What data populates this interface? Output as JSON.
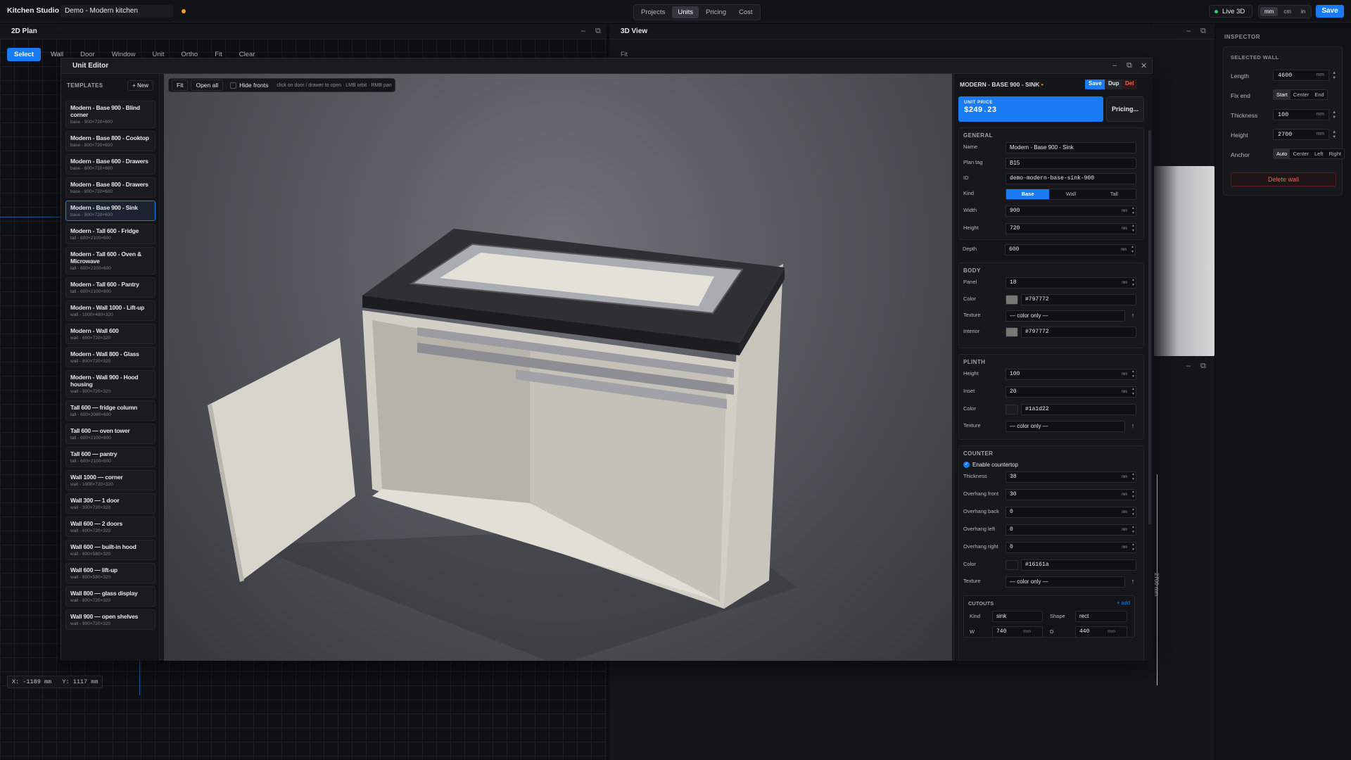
{
  "topbar": {
    "app_title": "Kitchen Studio",
    "project_name": "Demo - Modern kitchen",
    "nav": [
      "Projects",
      "Units",
      "Pricing",
      "Cost"
    ],
    "nav_active": "Units",
    "live3d": "Live 3D",
    "units": [
      "mm",
      "cm",
      "in"
    ],
    "units_active": "mm",
    "save": "Save"
  },
  "plan": {
    "title": "2D Plan",
    "tools": [
      "Select",
      "Wall",
      "Door",
      "Window",
      "Unit",
      "Ortho",
      "Fit",
      "Clear"
    ],
    "coord_x": "X: -1189 mm",
    "coord_y": "Y: 1117 mm"
  },
  "view3d": {
    "title": "3D View",
    "fit": "Fit",
    "dim_label": "2700 mm"
  },
  "inspector": {
    "title": "INSPECTOR",
    "section": "SELECTED WALL",
    "length_label": "Length",
    "length": "4600",
    "unit": "mm",
    "fixend_label": "Fix end",
    "fixend_opts": [
      "Start",
      "Center",
      "End"
    ],
    "fixend_active": "Start",
    "thickness_label": "Thickness",
    "thickness": "100",
    "height_label": "Height",
    "height": "2700",
    "anchor_label": "Anchor",
    "anchor_opts": [
      "Auto",
      "Center",
      "Left",
      "Right"
    ],
    "anchor_active": "Auto",
    "delete": "Delete wall"
  },
  "editor": {
    "title": "Unit Editor",
    "templates_heading": "TEMPLATES",
    "new_btn": "+ New",
    "templates": [
      {
        "name": "Modern - Base 900 - Blind corner",
        "sub": "base - 900×720×600"
      },
      {
        "name": "Modern - Base 800 - Cooktop",
        "sub": "base - 800×720×600"
      },
      {
        "name": "Modern - Base 600 - Drawers",
        "sub": "base - 600×720×600"
      },
      {
        "name": "Modern - Base 800 - Drawers",
        "sub": "base - 800×720×600"
      },
      {
        "name": "Modern - Base 900 - Sink",
        "sub": "base - 900×720×600"
      },
      {
        "name": "Modern - Tall 600 - Fridge",
        "sub": "tall - 600×2100×600"
      },
      {
        "name": "Modern - Tall 600 - Oven & Microwave",
        "sub": "tall - 600×2100×600"
      },
      {
        "name": "Modern - Tall 600 - Pantry",
        "sub": "tall - 600×2100×600"
      },
      {
        "name": "Modern - Wall 1000 - Lift-up",
        "sub": "wall - 1000×480×320"
      },
      {
        "name": "Modern - Wall 600",
        "sub": "wall - 600×720×320"
      },
      {
        "name": "Modern - Wall 800 - Glass",
        "sub": "wall - 800×720×320"
      },
      {
        "name": "Modern - Wall 900 - Hood housing",
        "sub": "wall - 900×720×320"
      },
      {
        "name": "Tall 600 — fridge column",
        "sub": "tall - 600×2080×600"
      },
      {
        "name": "Tall 600 — oven tower",
        "sub": "tall - 600×2100×600"
      },
      {
        "name": "Tall 600 — pantry",
        "sub": "tall - 600×2100×600"
      },
      {
        "name": "Wall 1000 — corner",
        "sub": "wall - 1000×720×320"
      },
      {
        "name": "Wall 300 — 1 door",
        "sub": "wall - 300×720×320"
      },
      {
        "name": "Wall 600 — 2 doors",
        "sub": "wall - 600×720×320"
      },
      {
        "name": "Wall 600 — built-in hood",
        "sub": "wall - 600×580×320"
      },
      {
        "name": "Wall 600 — lift-up",
        "sub": "wall - 600×580×320"
      },
      {
        "name": "Wall 800 — glass display",
        "sub": "wall - 800×720×320"
      },
      {
        "name": "Wall 900 — open shelves",
        "sub": "wall - 900×720×320"
      }
    ],
    "selected_index": 4,
    "viewport": {
      "fit": "Fit",
      "open_all": "Open all",
      "hide_fronts": "Hide fronts",
      "hint": "click on door / drawer to open · LMB orbit · RMB pan"
    }
  },
  "props": {
    "title": "MODERN - BASE 900 - SINK",
    "dirty": "•",
    "save": "Save",
    "dup": "Dup",
    "del": "Del",
    "price_label": "UNIT PRICE",
    "price": "$249.23",
    "pricing_btn": "Pricing...",
    "general": {
      "heading": "GENERAL",
      "name_label": "Name",
      "name": "Modern - Base 900 - Sink",
      "tag_label": "Plan tag",
      "tag": "B15",
      "id_label": "ID",
      "id": "demo-modern-base-sink-900",
      "kind_label": "Kind",
      "kinds": [
        "Base",
        "Wall",
        "Tall"
      ],
      "kind_active": "Base",
      "width_label": "Width",
      "width": "900",
      "height_label": "Height",
      "height": "720",
      "depth_label": "Depth",
      "depth": "600",
      "unit": "mm"
    },
    "body": {
      "heading": "BODY",
      "panel_label": "Panel",
      "panel": "18",
      "color_label": "Color",
      "color": "#797772",
      "texture_label": "Texture",
      "texture": "— color only —",
      "interior_label": "Interior",
      "interior": "#797772"
    },
    "plinth": {
      "heading": "PLINTH",
      "height_label": "Height",
      "height": "100",
      "inset_label": "Inset",
      "inset": "20",
      "color_label": "Color",
      "color": "#1a1d22",
      "texture_label": "Texture",
      "texture": "— color only —"
    },
    "counter": {
      "heading": "COUNTER",
      "enable": "Enable countertop",
      "thickness_label": "Thickness",
      "thickness": "38",
      "of_label": "Overhang front",
      "of": "30",
      "ob_label": "Overhang back",
      "ob": "0",
      "ol_label": "Overhang left",
      "ol": "0",
      "or_label": "Overhang right",
      "or": "0",
      "color_label": "Color",
      "color": "#16161a",
      "texture_label": "Texture",
      "texture": "— color only —"
    },
    "cutouts": {
      "heading": "CUTOUTS",
      "add": "+ add",
      "kind_label": "Kind",
      "kind": "sink",
      "shape_label": "Shape",
      "shape": "rect",
      "w_label": "W",
      "w": "740",
      "d_label": "D",
      "d": "440"
    }
  },
  "colors": {
    "accent": "#1a7cf5",
    "dirty": "#f0a020",
    "danger": "#ff5a5a",
    "live": "#2ecc71"
  }
}
